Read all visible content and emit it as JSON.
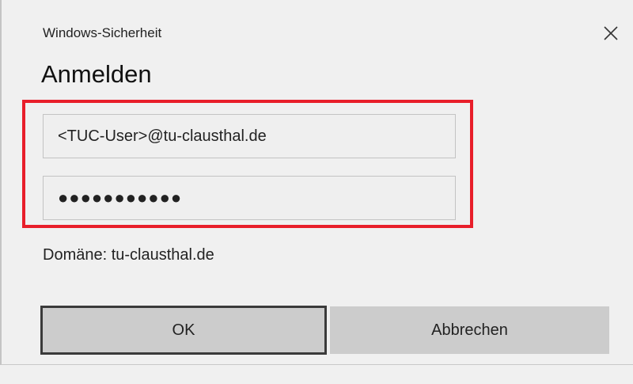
{
  "window": {
    "title": "Windows-Sicherheit",
    "close_icon": "close-icon"
  },
  "heading": "Anmelden",
  "form": {
    "username_value": "<TUC-User>@tu-clausthal.de",
    "password_value": "●●●●●●●●●●●",
    "highlight_color": "#e81e2a"
  },
  "domain": {
    "label": "Domäne:",
    "value": "tu-clausthal.de"
  },
  "buttons": {
    "ok_label": "OK",
    "cancel_label": "Abbrechen"
  }
}
